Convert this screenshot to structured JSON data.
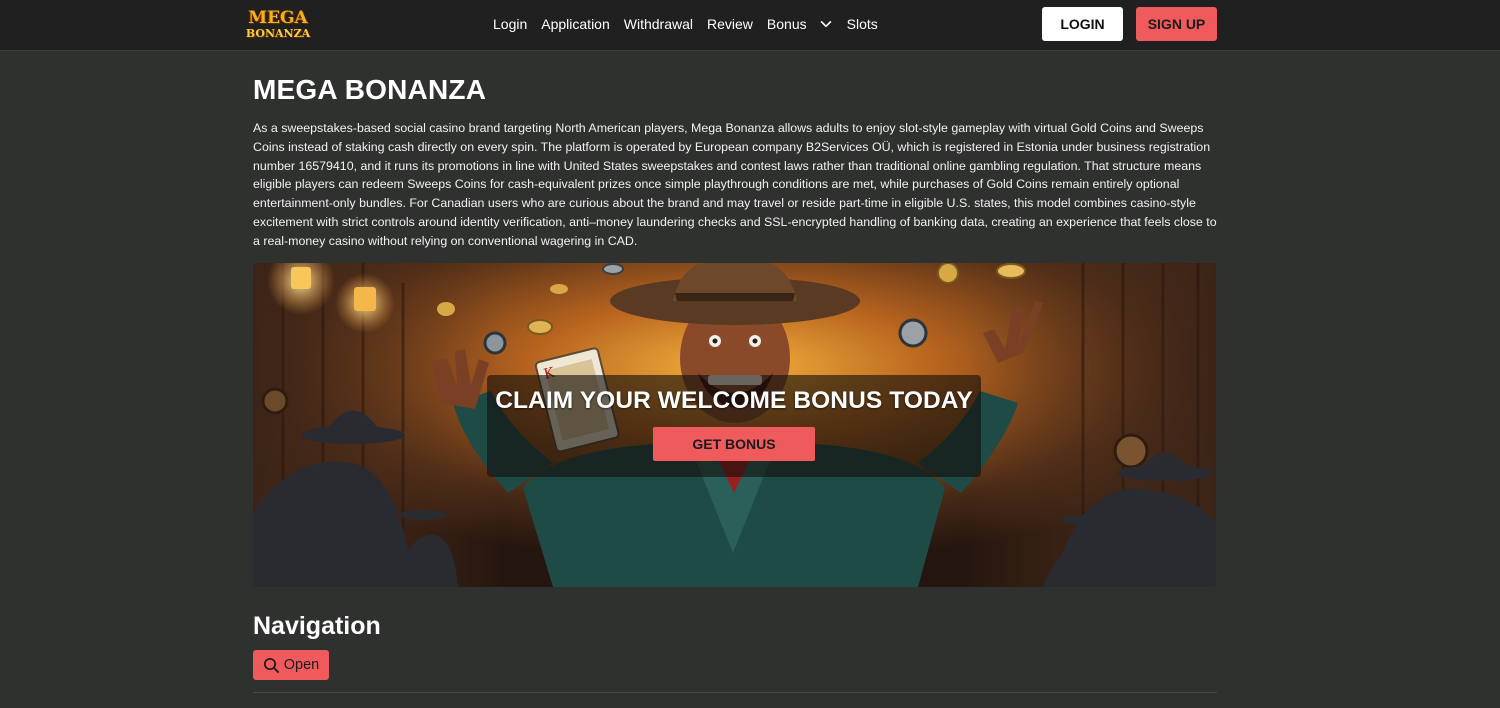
{
  "brand": {
    "logo_line1": "MEGA",
    "logo_line2": "BONANZA"
  },
  "header": {
    "nav": {
      "login": "Login",
      "application": "Application",
      "withdrawal": "Withdrawal",
      "review": "Review",
      "bonus": "Bonus",
      "slots": "Slots"
    },
    "login_button": "LOGIN",
    "signup_button": "SIGN UP"
  },
  "main": {
    "title": "MEGA BONANZA",
    "intro": "As a sweepstakes-based social casino brand targeting North American players, Mega Bonanza allows adults to enjoy slot-style gameplay with virtual Gold Coins and Sweeps Coins instead of staking cash directly on every spin. The platform is operated by European company B2Services OÜ, which is registered in Estonia under business registration number 16579410, and it runs its promotions in line with United States sweepstakes and contest laws rather than traditional online gambling regulation. That structure means eligible players can redeem Sweeps Coins for cash-equivalent prizes once simple playthrough conditions are met, while purchases of Gold Coins remain entirely optional entertainment-only bundles. For Canadian users who are curious about the brand and may travel or reside part-time in eligible U.S. states, this model combines casino-style excitement with strict controls around identity verification, anti–money laundering checks and SSL-encrypted handling of banking data, creating an experience that feels close to a real-money casino without relying on conventional wagering in CAD.",
    "hero": {
      "headline": "CLAIM YOUR WELCOME BONUS TODAY",
      "button": "GET BONUS"
    },
    "navigation": {
      "heading": "Navigation",
      "open_button": "Open"
    }
  },
  "colors": {
    "background": "#2f312f",
    "header": "#1f201f",
    "accent": "#ef5a5c",
    "logo_gold": "#f2b21b"
  },
  "icons": {
    "bonus_dropdown": "chevron-down-icon",
    "open_button": "search-icon"
  }
}
